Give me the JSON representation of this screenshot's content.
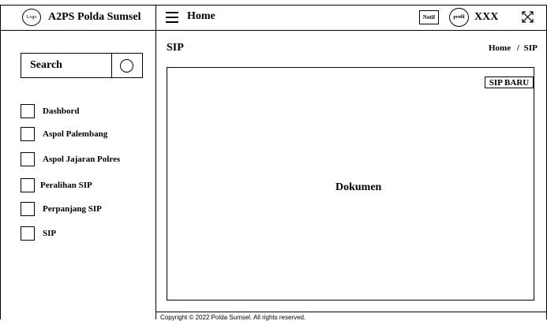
{
  "brand": {
    "logo_label": "Logo",
    "name": "A2PS Polda Sumsel"
  },
  "header": {
    "menu_label": "Home",
    "notif_label": "Notif",
    "profile_label": "profil",
    "username": "XXX"
  },
  "sidebar": {
    "search_label": "Search",
    "items": [
      {
        "label": "Dashbord"
      },
      {
        "label": "Aspol Palembang"
      },
      {
        "label": "Aspol Jajaran Polres"
      },
      {
        "label": "Peralihan SIP"
      },
      {
        "label": "Perpanjang SIP"
      },
      {
        "label": "SIP"
      }
    ]
  },
  "main": {
    "page_title": "SIP",
    "breadcrumb": {
      "home": "Home",
      "separator": "/",
      "current": "SIP"
    },
    "new_button_label": "SIP BARU",
    "content_label": "Dokumen"
  },
  "footer": {
    "copyright": "Copyright © 2022 Polda Sumsel. All rights reserved."
  }
}
